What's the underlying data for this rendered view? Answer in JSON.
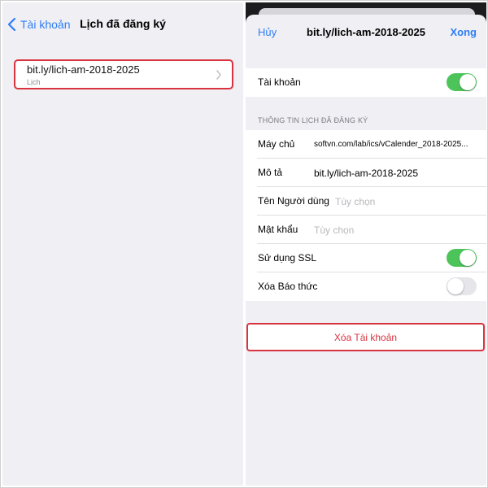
{
  "left": {
    "back_label": "Tài khoản",
    "title": "Lịch đã đăng ký",
    "calendar": {
      "name": "bit.ly/lich-am-2018-2025",
      "subtitle": "Lịch"
    }
  },
  "right": {
    "cancel_label": "Hủy",
    "title": "bit.ly/lich-am-2018-2025",
    "done_label": "Xong",
    "account_row": {
      "label": "Tài khoản",
      "toggle_on": true
    },
    "section_header": "THÔNG TIN LỊCH ĐÃ ĐĂNG KÝ",
    "fields": {
      "server_label": "Máy chủ",
      "server_value": "softvn.com/lab/ics/vCalender_2018-2025...",
      "description_label": "Mô tả",
      "description_value": "bit.ly/lich-am-2018-2025",
      "username_label": "Tên Người dùng",
      "username_placeholder": "Tùy chọn",
      "password_label": "Mật khẩu",
      "password_placeholder": "Tùy chọn",
      "ssl_label": "Sử dụng SSL",
      "ssl_on": true,
      "remove_alarms_label": "Xóa Báo thức",
      "remove_alarms_on": false
    },
    "delete_label": "Xóa Tài khoản"
  },
  "colors": {
    "accent": "#2f7ef6",
    "toggle_on": "#4cc45a",
    "highlight": "#d9333f",
    "group_bg": "#efeff4"
  }
}
